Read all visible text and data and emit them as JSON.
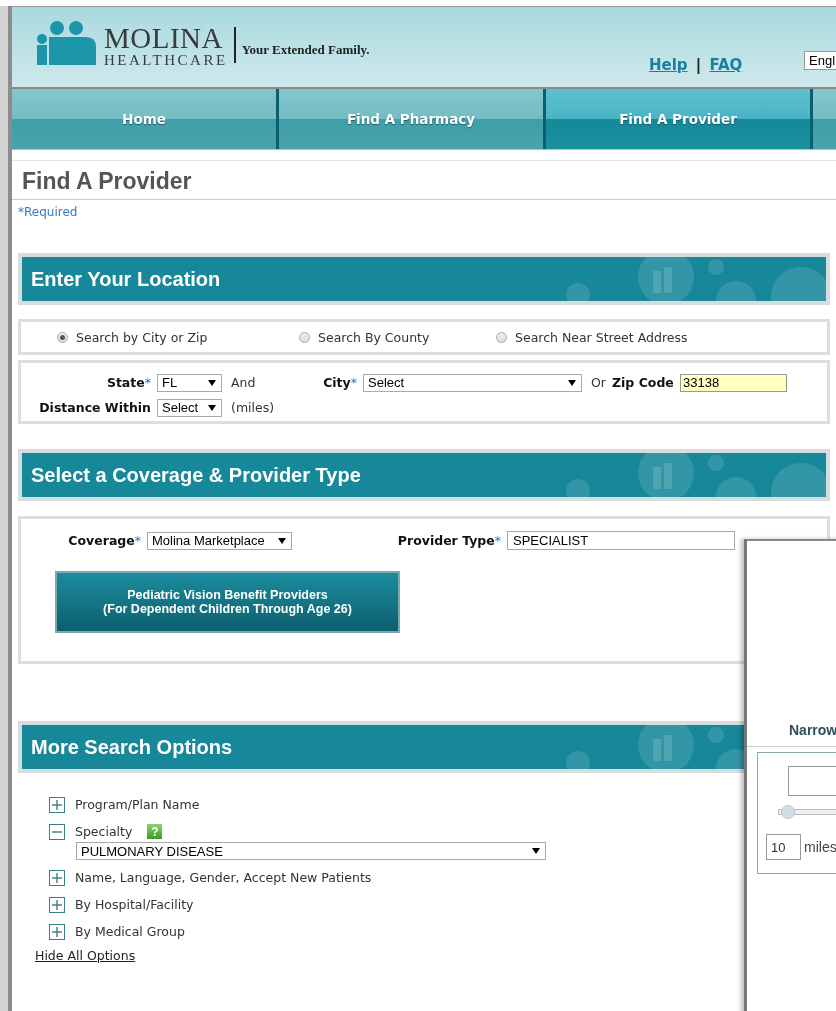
{
  "header": {
    "logo_top": "MOLINA",
    "logo_bottom": "HEALTHCARE",
    "tagline": "Your Extended Family.",
    "links": [
      "Help",
      "FAQ"
    ],
    "separator": "|",
    "language": "Engl"
  },
  "nav": [
    {
      "label": "Home",
      "selected": false
    },
    {
      "label": "Find A Pharmacy",
      "selected": false
    },
    {
      "label": "Find A Provider",
      "selected": true
    }
  ],
  "page_title": "Find A Provider",
  "required_note": "*Required",
  "location": {
    "heading": "Enter Your Location",
    "search_modes": [
      {
        "label": "Search by City or Zip",
        "selected": true
      },
      {
        "label": "Search By County",
        "selected": false
      },
      {
        "label": "Search Near Street Address",
        "selected": false
      }
    ],
    "state": {
      "label": "State",
      "mark": "*",
      "value": "FL"
    },
    "and": "And",
    "city": {
      "label": "City",
      "mark": "*",
      "value": "Select"
    },
    "or": "Or",
    "zip": {
      "label": "Zip Code",
      "value": "33138"
    },
    "distance": {
      "label": "Distance Within",
      "value": "Select"
    },
    "units": "(miles)"
  },
  "coverage": {
    "heading": "Select a Coverage & Provider Type",
    "coverage": {
      "label": "Coverage",
      "mark": "*",
      "value": "Molina Marketplace"
    },
    "provider_type": {
      "label": "Provider Type",
      "mark": "*",
      "value": "SPECIALIST"
    },
    "button": [
      "Pediatric Vision Benefit Providers",
      "(For Dependent Children Through Age 26)"
    ]
  },
  "more_options": {
    "heading": "More Search Options",
    "options": [
      {
        "label": "Program/Plan Name",
        "expanded": false
      },
      {
        "label": "Specialty",
        "expanded": true,
        "help": "?",
        "value": "PULMONARY DISEASE"
      },
      {
        "label": "Name, Language, Gender, Accept New Patients",
        "expanded": false
      },
      {
        "label": "By Hospital/Facility",
        "expanded": false
      },
      {
        "label": "By Medical Group",
        "expanded": false
      }
    ],
    "hide_link": "Hide All Options"
  },
  "overlay": {
    "title": "Narrow",
    "slider": {
      "level": 0.03
    },
    "miles_value": "10",
    "miles_label": "miles"
  }
}
